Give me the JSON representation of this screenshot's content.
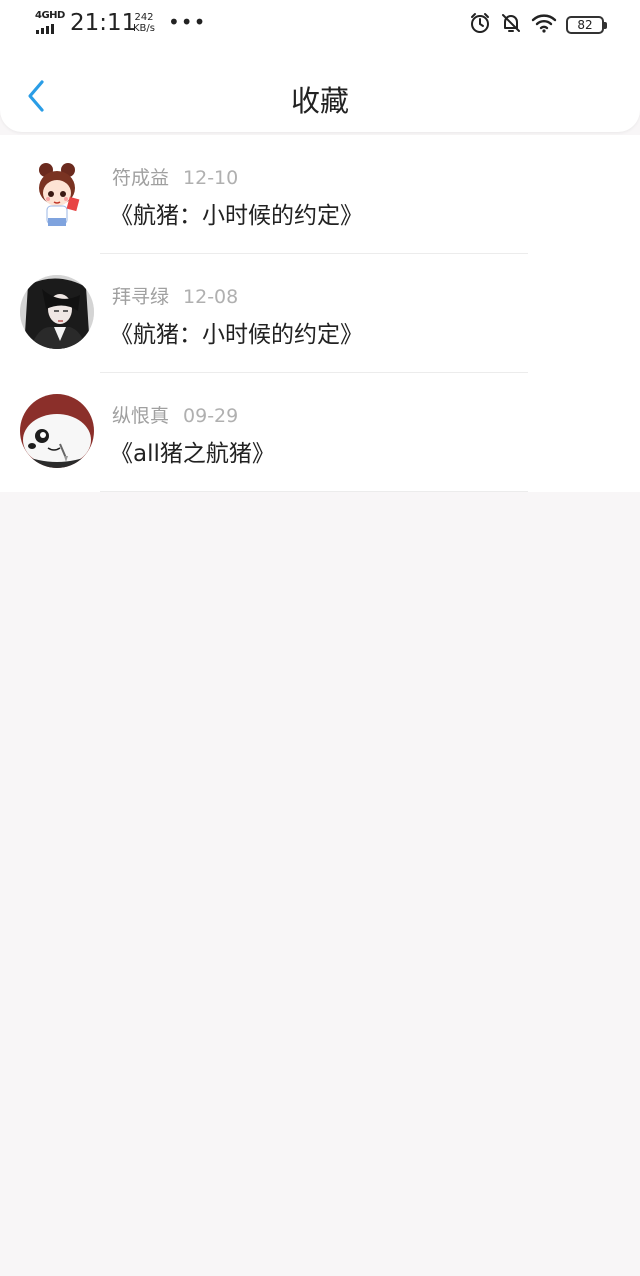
{
  "status_bar": {
    "network": "4GHD",
    "time": "21:11",
    "speed_value": "242",
    "speed_unit": "KB/s",
    "more": "•••",
    "battery": "82",
    "icons": [
      "alarm-icon",
      "bell-off-icon",
      "wifi-icon",
      "battery-icon"
    ]
  },
  "header": {
    "title": "收藏",
    "back_icon": "chevron-left-icon"
  },
  "colors": {
    "accent": "#2a9de6",
    "background": "#f8f6f7",
    "meta_text": "#a0a0a0"
  },
  "favorites": [
    {
      "author": "符成益",
      "date": "12-10",
      "title": "《航猪：小时候的约定》",
      "avatar": "cartoon-girl-avatar"
    },
    {
      "author": "拜寻绿",
      "date": "12-08",
      "title": "《航猪：小时候的约定》",
      "avatar": "dark-hair-character-avatar"
    },
    {
      "author": "纵恨真",
      "date": "09-29",
      "title": "《all猪之航猪》",
      "avatar": "panda-avatar"
    }
  ]
}
